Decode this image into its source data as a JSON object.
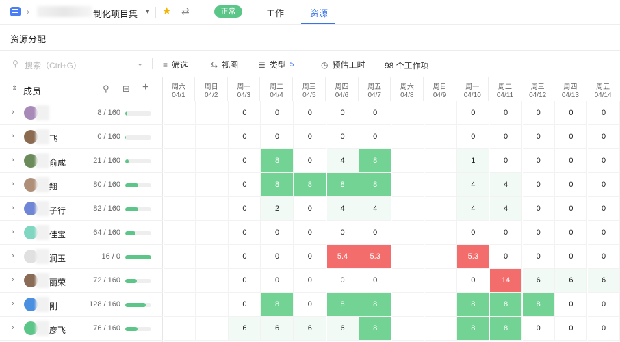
{
  "header": {
    "project_title": "制化项目集",
    "status": "正常",
    "tabs": [
      "工作",
      "资源"
    ],
    "active_tab": "资源"
  },
  "section_title": "资源分配",
  "toolbar": {
    "search_placeholder": "搜索（Ctrl+G）",
    "filter": "筛选",
    "view": "视图",
    "type": "类型",
    "type_count": "5",
    "estimate": "预估工时",
    "item_count": "98 个工作项"
  },
  "members_header": "成员",
  "members": [
    {
      "name": "",
      "load": "8 / 160",
      "fill": 0.05,
      "avatar": "#a88ab8"
    },
    {
      "name": "飞",
      "load": "0 / 160",
      "fill": 0.0,
      "avatar": "#8b6a4f"
    },
    {
      "name": "俞成",
      "load": "21 / 160",
      "fill": 0.13,
      "avatar": "#6b8c5a"
    },
    {
      "name": "翔",
      "load": "80 / 160",
      "fill": 0.5,
      "avatar": "#b08f78"
    },
    {
      "name": "子行",
      "load": "82 / 160",
      "fill": 0.51,
      "avatar": "#6f86d6"
    },
    {
      "name": "佳宝",
      "load": "64 / 160",
      "fill": 0.4,
      "avatar": "#7fd6c1"
    },
    {
      "name": "润玉",
      "load": "16 / 0",
      "fill": 1.0,
      "avatar": "#e0e0e0"
    },
    {
      "name": "丽荣",
      "load": "72 / 160",
      "fill": 0.45,
      "avatar": "#8a6b55"
    },
    {
      "name": "刚",
      "load": "128 / 160",
      "fill": 0.8,
      "avatar": "#4a8fe0"
    },
    {
      "name": "彦飞",
      "load": "76 / 160",
      "fill": 0.48,
      "avatar": "#5cc689"
    }
  ],
  "days": [
    {
      "wk": "周六",
      "dt": "04/1",
      "weekend": true
    },
    {
      "wk": "周日",
      "dt": "04/2",
      "weekend": true
    },
    {
      "wk": "周一",
      "dt": "04/3"
    },
    {
      "wk": "周二",
      "dt": "04/4"
    },
    {
      "wk": "周三",
      "dt": "04/5"
    },
    {
      "wk": "周四",
      "dt": "04/6"
    },
    {
      "wk": "周五",
      "dt": "04/7"
    },
    {
      "wk": "周六",
      "dt": "04/8",
      "weekend": true
    },
    {
      "wk": "周日",
      "dt": "04/9",
      "weekend": true
    },
    {
      "wk": "周一",
      "dt": "04/10"
    },
    {
      "wk": "周二",
      "dt": "04/11"
    },
    {
      "wk": "周三",
      "dt": "04/12"
    },
    {
      "wk": "周四",
      "dt": "04/13"
    },
    {
      "wk": "周五",
      "dt": "04/14"
    }
  ],
  "cells": [
    [
      "",
      "",
      "0",
      "0",
      "0",
      "0",
      "0",
      "",
      "",
      "0",
      "0",
      "0",
      "0",
      "0"
    ],
    [
      "",
      "",
      "0",
      "0",
      "0",
      "0",
      "0",
      "",
      "",
      "0",
      "0",
      "0",
      "0",
      "0"
    ],
    [
      "",
      "",
      "0",
      "8",
      "0",
      "4",
      "8",
      "",
      "",
      "1",
      "0",
      "0",
      "0",
      "0"
    ],
    [
      "",
      "",
      "0",
      "8",
      "8",
      "8",
      "8",
      "",
      "",
      "4",
      "4",
      "0",
      "0",
      "0"
    ],
    [
      "",
      "",
      "0",
      "2",
      "0",
      "4",
      "4",
      "",
      "",
      "4",
      "4",
      "0",
      "0",
      "0"
    ],
    [
      "",
      "",
      "0",
      "0",
      "0",
      "0",
      "0",
      "",
      "",
      "0",
      "0",
      "0",
      "0",
      "0"
    ],
    [
      "",
      "",
      "0",
      "0",
      "0",
      "5.4",
      "5.3",
      "",
      "",
      "5.3",
      "0",
      "0",
      "0",
      "0"
    ],
    [
      "",
      "",
      "0",
      "0",
      "0",
      "0",
      "0",
      "",
      "",
      "0",
      "14",
      "6",
      "6",
      "6"
    ],
    [
      "",
      "",
      "0",
      "8",
      "0",
      "8",
      "8",
      "",
      "",
      "8",
      "8",
      "8",
      "0",
      "0"
    ],
    [
      "",
      "",
      "6",
      "6",
      "6",
      "6",
      "8",
      "",
      "",
      "8",
      "8",
      "0",
      "0",
      "0"
    ]
  ],
  "cell_status": [
    [
      "w",
      "w",
      "n",
      "n",
      "n",
      "n",
      "n",
      "w",
      "w",
      "n",
      "n",
      "n",
      "n",
      "n"
    ],
    [
      "w",
      "w",
      "n",
      "n",
      "n",
      "n",
      "n",
      "w",
      "w",
      "n",
      "n",
      "n",
      "n",
      "n"
    ],
    [
      "w",
      "w",
      "n",
      "g",
      "n",
      "l",
      "g",
      "w",
      "w",
      "l",
      "n",
      "n",
      "n",
      "n"
    ],
    [
      "w",
      "w",
      "n",
      "g",
      "g",
      "g",
      "g",
      "w",
      "w",
      "l",
      "l",
      "n",
      "n",
      "n"
    ],
    [
      "w",
      "w",
      "n",
      "l",
      "n",
      "l",
      "l",
      "w",
      "w",
      "l",
      "l",
      "n",
      "n",
      "n"
    ],
    [
      "w",
      "w",
      "n",
      "n",
      "n",
      "n",
      "n",
      "w",
      "w",
      "n",
      "n",
      "n",
      "n",
      "n"
    ],
    [
      "w",
      "w",
      "n",
      "n",
      "n",
      "r",
      "r",
      "w",
      "w",
      "r",
      "n",
      "n",
      "n",
      "n"
    ],
    [
      "w",
      "w",
      "n",
      "n",
      "n",
      "n",
      "n",
      "w",
      "w",
      "n",
      "r",
      "l",
      "l",
      "l"
    ],
    [
      "w",
      "w",
      "n",
      "g",
      "n",
      "g",
      "g",
      "w",
      "w",
      "g",
      "g",
      "g",
      "n",
      "n"
    ],
    [
      "w",
      "w",
      "l",
      "l",
      "l",
      "l",
      "g",
      "w",
      "w",
      "g",
      "g",
      "n",
      "n",
      "n"
    ]
  ],
  "colors": {
    "accent": "#3a73e8",
    "ok": "#72d394",
    "over": "#f36d6d",
    "status": "#5cc689"
  }
}
